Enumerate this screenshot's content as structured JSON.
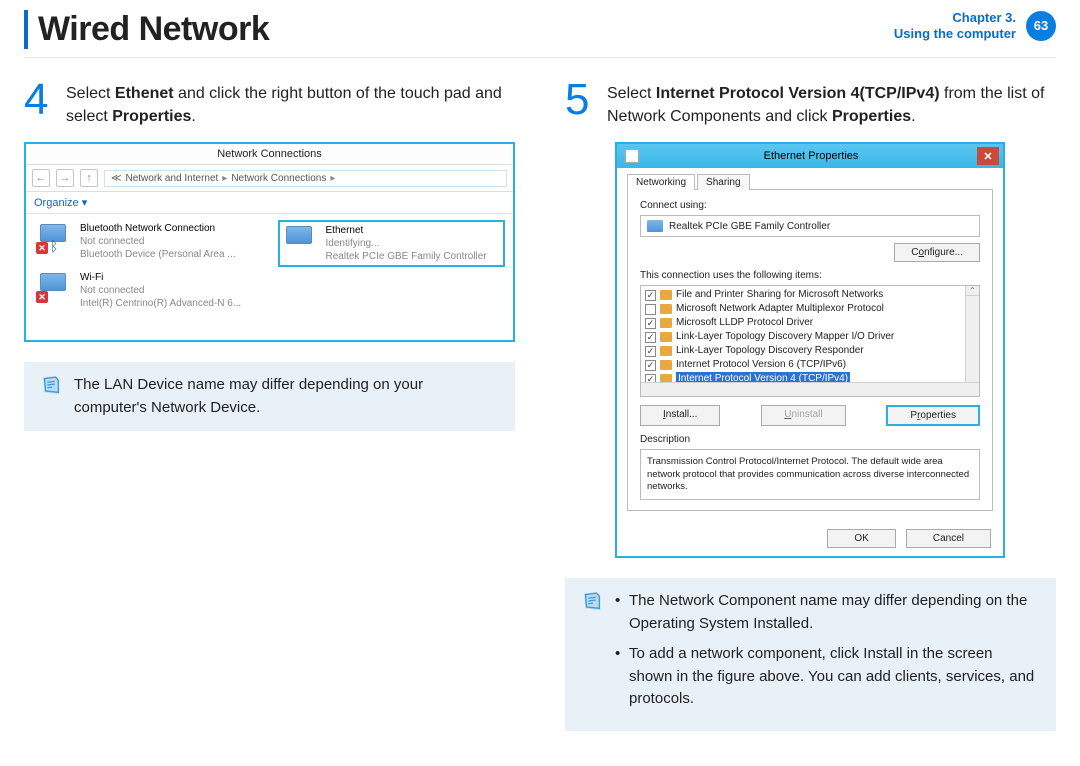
{
  "header": {
    "title": "Wired Network",
    "chapter_line1": "Chapter 3.",
    "chapter_line2": "Using the computer",
    "page": "63"
  },
  "left": {
    "step_num": "4",
    "step_html": "Select <b>Ethenet</b> and click the right button of the touch pad and select <b>Properties</b>.",
    "callout": "The LAN Device name may differ depending on your computer's Network Device."
  },
  "right": {
    "step_num": "5",
    "step_html": "Select <b>Internet Protocol Version 4(TCP/IPv4)</b> from the list of Network Components and click <b>Properties</b>.",
    "callout1": "The Network Component name may differ depending on the Operating System Installed.",
    "callout2": "To add a network component, click Install in the screen shown in the figure above. You can add clients, services, and protocols."
  },
  "nc": {
    "title": "Network Connections",
    "crumb1": "Network and Internet",
    "crumb2": "Network Connections",
    "organize": "Organize ▾",
    "items": [
      {
        "name": "Bluetooth Network Connection",
        "status": "Not connected",
        "dev": "Bluetooth Device (Personal Area ...",
        "bt": true
      },
      {
        "name": "Wi-Fi",
        "status": "Not connected",
        "dev": "Intel(R) Centrino(R) Advanced-N 6...",
        "bt": false
      },
      {
        "name": "Ethernet",
        "status": "Identifying...",
        "dev": "Realtek PCIe GBE Family Controller",
        "bt": false,
        "selected": true
      }
    ]
  },
  "ep": {
    "title": "Ethernet Properties",
    "tab1": "Networking",
    "tab2": "Sharing",
    "connect_label": "Connect using:",
    "adapter": "Realtek PCIe GBE Family Controller",
    "configure": "Configure...",
    "uses_label": "This connection uses the following items:",
    "items": [
      {
        "checked": true,
        "label": "File and Printer Sharing for Microsoft Networks"
      },
      {
        "checked": false,
        "label": "Microsoft Network Adapter Multiplexor Protocol"
      },
      {
        "checked": true,
        "label": "Microsoft LLDP Protocol Driver"
      },
      {
        "checked": true,
        "label": "Link-Layer Topology Discovery Mapper I/O Driver"
      },
      {
        "checked": true,
        "label": "Link-Layer Topology Discovery Responder"
      },
      {
        "checked": true,
        "label": "Internet Protocol Version 6 (TCP/IPv6)"
      },
      {
        "checked": true,
        "label": "Internet Protocol Version 4 (TCP/IPv4)",
        "selected": true
      }
    ],
    "install": "Install...",
    "uninstall": "Uninstall",
    "properties": "Properties",
    "desc_label": "Description",
    "desc": "Transmission Control Protocol/Internet Protocol. The default wide area network protocol that provides communication across diverse interconnected networks.",
    "ok": "OK",
    "cancel": "Cancel"
  }
}
